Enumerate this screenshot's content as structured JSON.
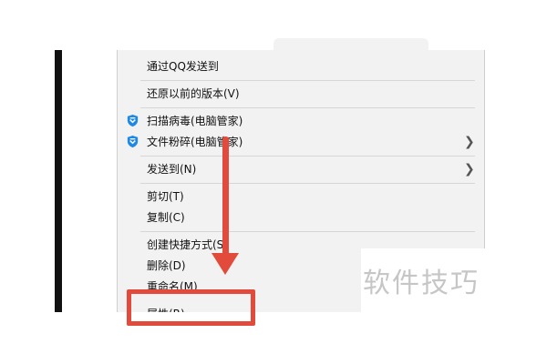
{
  "menu": {
    "items": [
      {
        "label": "通过QQ发送到"
      },
      {
        "label": "还原以前的版本(V)"
      },
      {
        "label": "扫描病毒(电脑管家)",
        "icon": "shield-icon"
      },
      {
        "label": "文件粉碎(电脑管家)",
        "icon": "shield-icon",
        "submenu": true
      },
      {
        "label": "发送到(N)",
        "submenu": true
      },
      {
        "label": "剪切(T)"
      },
      {
        "label": "复制(C)"
      },
      {
        "label": "创建快捷方式(S)"
      },
      {
        "label": "删除(D)"
      },
      {
        "label": "重命名(M)"
      },
      {
        "label": "属性(R)"
      }
    ],
    "submenu_glyph": "❯"
  },
  "annotation": {
    "color": "#e24a3b"
  },
  "watermark": {
    "text": "软件技巧"
  },
  "colors": {
    "menu_bg": "#f2f2f2",
    "separator": "#d6d6d6",
    "shield_blue": "#1e88e5"
  }
}
